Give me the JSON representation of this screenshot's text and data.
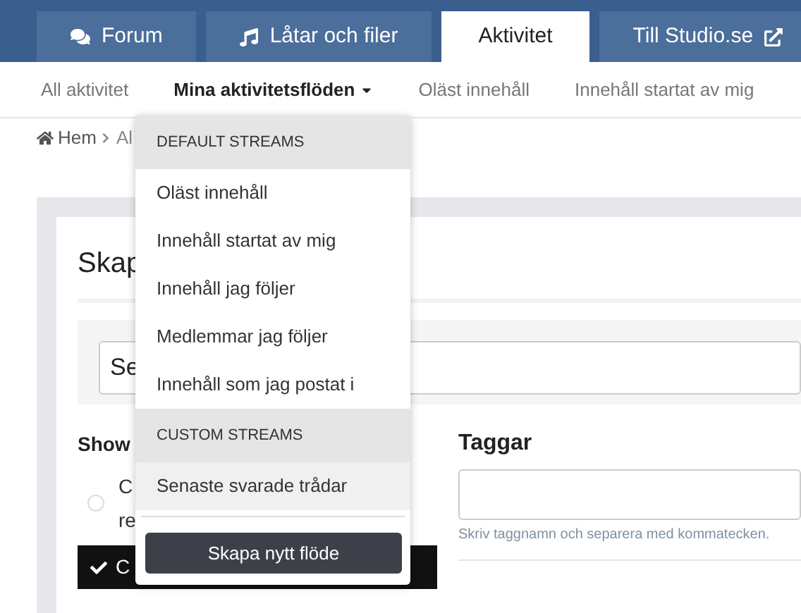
{
  "tabs": [
    {
      "label": "Forum",
      "selected": false
    },
    {
      "label": "Låtar och filer",
      "selected": false
    },
    {
      "label": "Aktivitet",
      "selected": true
    },
    {
      "label": "Till Studio.se",
      "selected": false
    }
  ],
  "subnav": [
    {
      "label": "All aktivitet",
      "selected": false,
      "dropdown": false
    },
    {
      "label": "Mina aktivitetsflöden",
      "selected": true,
      "dropdown": true
    },
    {
      "label": "Oläst innehåll",
      "selected": false,
      "dropdown": false
    },
    {
      "label": "Innehåll startat av mig",
      "selected": false,
      "dropdown": false
    }
  ],
  "breadcrumb": [
    "Hem",
    "Al"
  ],
  "form": {
    "title": "Skap",
    "search_value": "Se",
    "show_heading": "Show",
    "radio": {
      "lines": [
        "C",
        "re"
      ],
      "checked": false
    },
    "checked_option": "C",
    "tags_heading": "Taggar",
    "tags_hint": "Skriv taggnamn och separera med kommatecken."
  },
  "menu": {
    "sections": [
      {
        "heading": "DEFAULT STREAMS",
        "items": [
          {
            "label": "Oläst innehåll",
            "selected": false
          },
          {
            "label": "Innehåll startat av mig",
            "selected": false
          },
          {
            "label": "Innehåll jag följer",
            "selected": false
          },
          {
            "label": "Medlemmar jag följer",
            "selected": false
          },
          {
            "label": "Innehåll som jag postat i",
            "selected": false
          }
        ]
      },
      {
        "heading": "CUSTOM STREAMS",
        "items": [
          {
            "label": "Senaste svarade trådar",
            "selected": true
          }
        ]
      }
    ],
    "button": "Skapa nytt flöde"
  }
}
